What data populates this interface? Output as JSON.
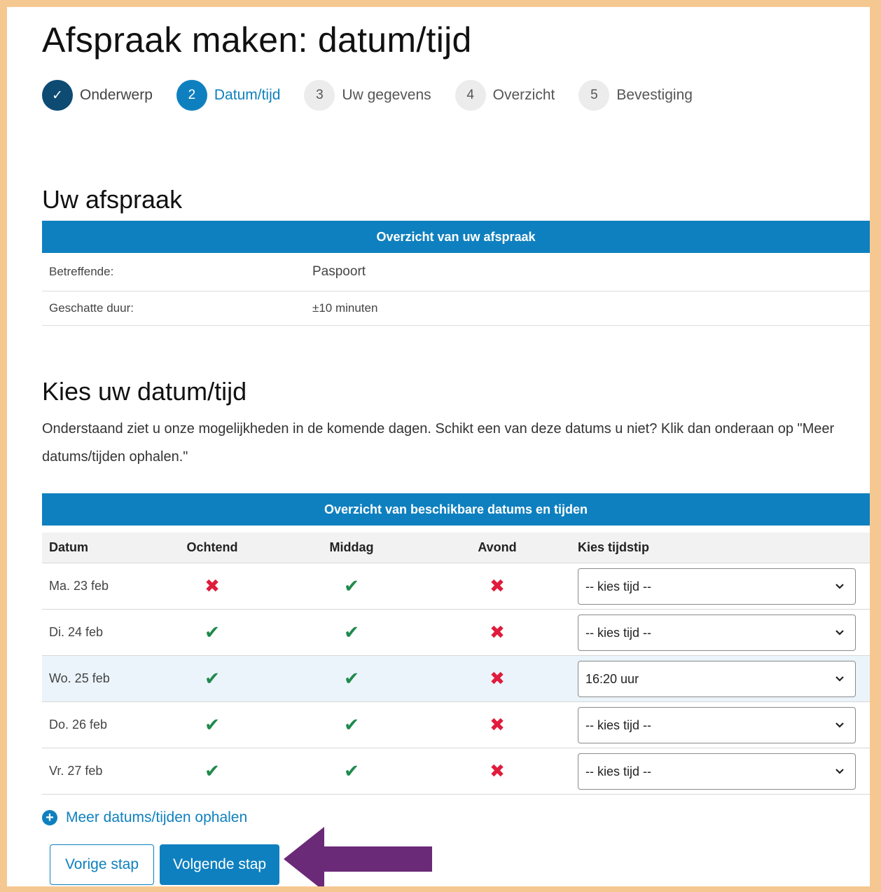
{
  "page": {
    "title": "Afspraak maken: datum/tijd"
  },
  "steps": [
    {
      "number": "✓",
      "label": "Onderwerp",
      "state": "done"
    },
    {
      "number": "2",
      "label": "Datum/tijd",
      "state": "active"
    },
    {
      "number": "3",
      "label": "Uw gegevens",
      "state": "pending"
    },
    {
      "number": "4",
      "label": "Overzicht",
      "state": "pending"
    },
    {
      "number": "5",
      "label": "Bevestiging",
      "state": "pending"
    }
  ],
  "appointment": {
    "heading": "Uw afspraak",
    "table_title": "Overzicht van uw afspraak",
    "rows": [
      {
        "label": "Betreffende:",
        "value": "Paspoort"
      },
      {
        "label": "Geschatte duur:",
        "value": "±10 minuten"
      }
    ]
  },
  "choose": {
    "heading": "Kies uw datum/tijd",
    "intro": "Onderstaand ziet u onze mogelijkheden in de komende dagen. Schikt een van deze datums u niet? Klik dan onderaan op \"Meer datums/tijden ophalen.\""
  },
  "availability": {
    "table_title": "Overzicht van beschikbare datums en tijden",
    "columns": [
      "Datum",
      "Ochtend",
      "Middag",
      "Avond",
      "Kies tijdstip"
    ],
    "rows": [
      {
        "date": "Ma. 23 feb",
        "morning": false,
        "afternoon": true,
        "evening": false,
        "time": "-- kies tijd --",
        "selected": false
      },
      {
        "date": "Di. 24 feb",
        "morning": true,
        "afternoon": true,
        "evening": false,
        "time": "-- kies tijd --",
        "selected": false
      },
      {
        "date": "Wo. 25 feb",
        "morning": true,
        "afternoon": true,
        "evening": false,
        "time": "16:20 uur",
        "selected": true
      },
      {
        "date": "Do. 26 feb",
        "morning": true,
        "afternoon": true,
        "evening": false,
        "time": "-- kies tijd --",
        "selected": false
      },
      {
        "date": "Vr. 27 feb",
        "morning": true,
        "afternoon": true,
        "evening": false,
        "time": "-- kies tijd --",
        "selected": false
      }
    ],
    "available_glyph": "✔",
    "unavailable_glyph": "✖"
  },
  "actions": {
    "more_link": "Meer datums/tijden ophalen",
    "prev_label": "Vorige stap",
    "next_label": "Volgende stap"
  },
  "colors": {
    "accent": "#0f80bf",
    "frame": "#f6c891",
    "arrow": "#6b2a78",
    "available": "#1f8a4c",
    "unavailable": "#e01c3c"
  },
  "icons": {
    "done_step": "checkmark-icon",
    "more": "plus-circle-icon",
    "select": "chevron-down-icon",
    "pointer": "arrow-left-icon"
  }
}
